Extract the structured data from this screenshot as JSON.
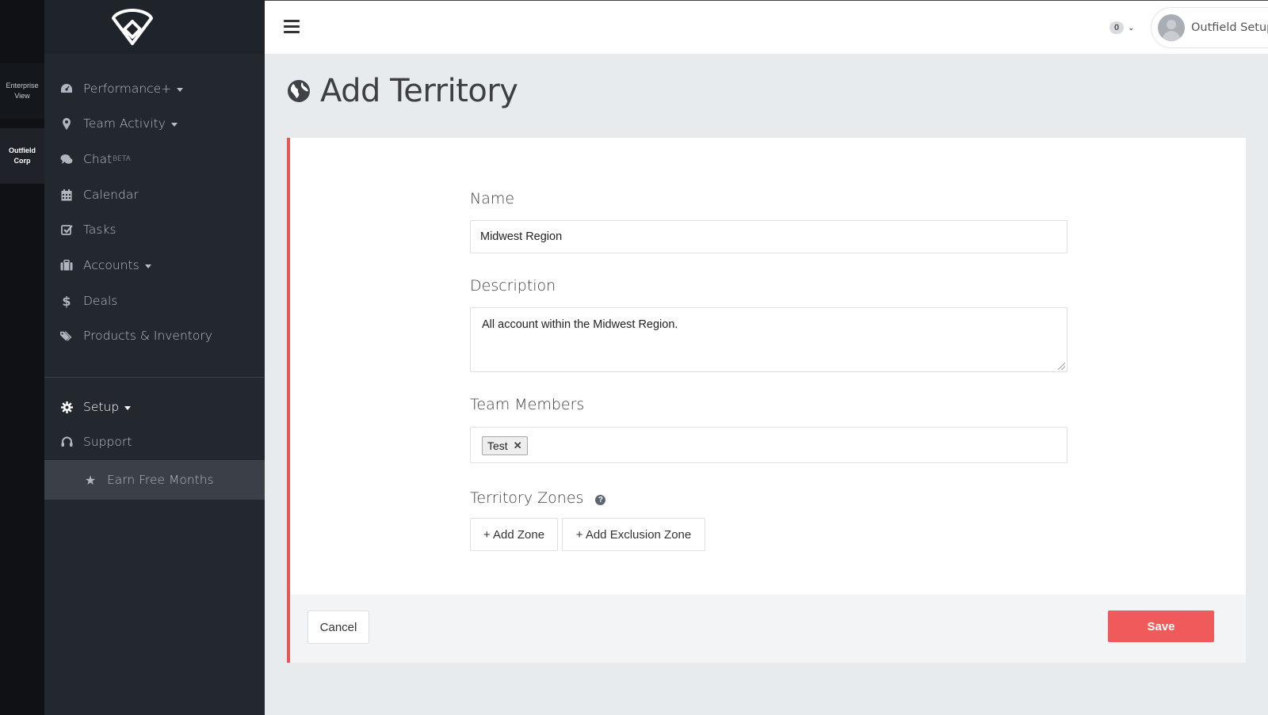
{
  "org_switcher": {
    "items": [
      {
        "label_line1": "Enterprise",
        "label_line2": "View"
      },
      {
        "label_line1": "Outfield",
        "label_line2": "Corp"
      }
    ]
  },
  "topbar": {
    "notification_count": "0",
    "user_name": "Outfield Setup"
  },
  "sidebar": {
    "items": [
      {
        "label": "Performance+",
        "icon": "dashboard-icon"
      },
      {
        "label": "Team Activity",
        "icon": "map-marker-icon"
      },
      {
        "label": "Chat",
        "sup": "BETA",
        "icon": "chat-icon"
      },
      {
        "label": "Calendar",
        "icon": "calendar-icon"
      },
      {
        "label": "Tasks",
        "icon": "check-square-icon"
      },
      {
        "label": "Accounts",
        "icon": "briefcase-icon"
      },
      {
        "label": "Deals",
        "icon": "dollar-icon"
      },
      {
        "label": "Products & Inventory",
        "icon": "tags-icon"
      }
    ],
    "setup": {
      "label": "Setup",
      "icon": "gear-icon"
    },
    "support": {
      "label": "Support",
      "icon": "headset-icon"
    },
    "earn": {
      "label": "Earn Free Months",
      "icon": "star-icon"
    }
  },
  "page": {
    "title": "Add Territory"
  },
  "form": {
    "name_label": "Name",
    "name_value": "Midwest Region",
    "description_label": "Description",
    "description_value": "All account within the Midwest Region.",
    "members_label": "Team Members",
    "members": [
      "Test"
    ],
    "zones_label": "Territory Zones",
    "add_zone_label": "+ Add Zone",
    "add_exclusion_label": "+ Add Exclusion Zone",
    "cancel_label": "Cancel",
    "save_label": "Save"
  },
  "colors": {
    "accent": "#f05a5a",
    "sidebar_bg": "#23272e",
    "page_bg": "#e8ebee"
  }
}
